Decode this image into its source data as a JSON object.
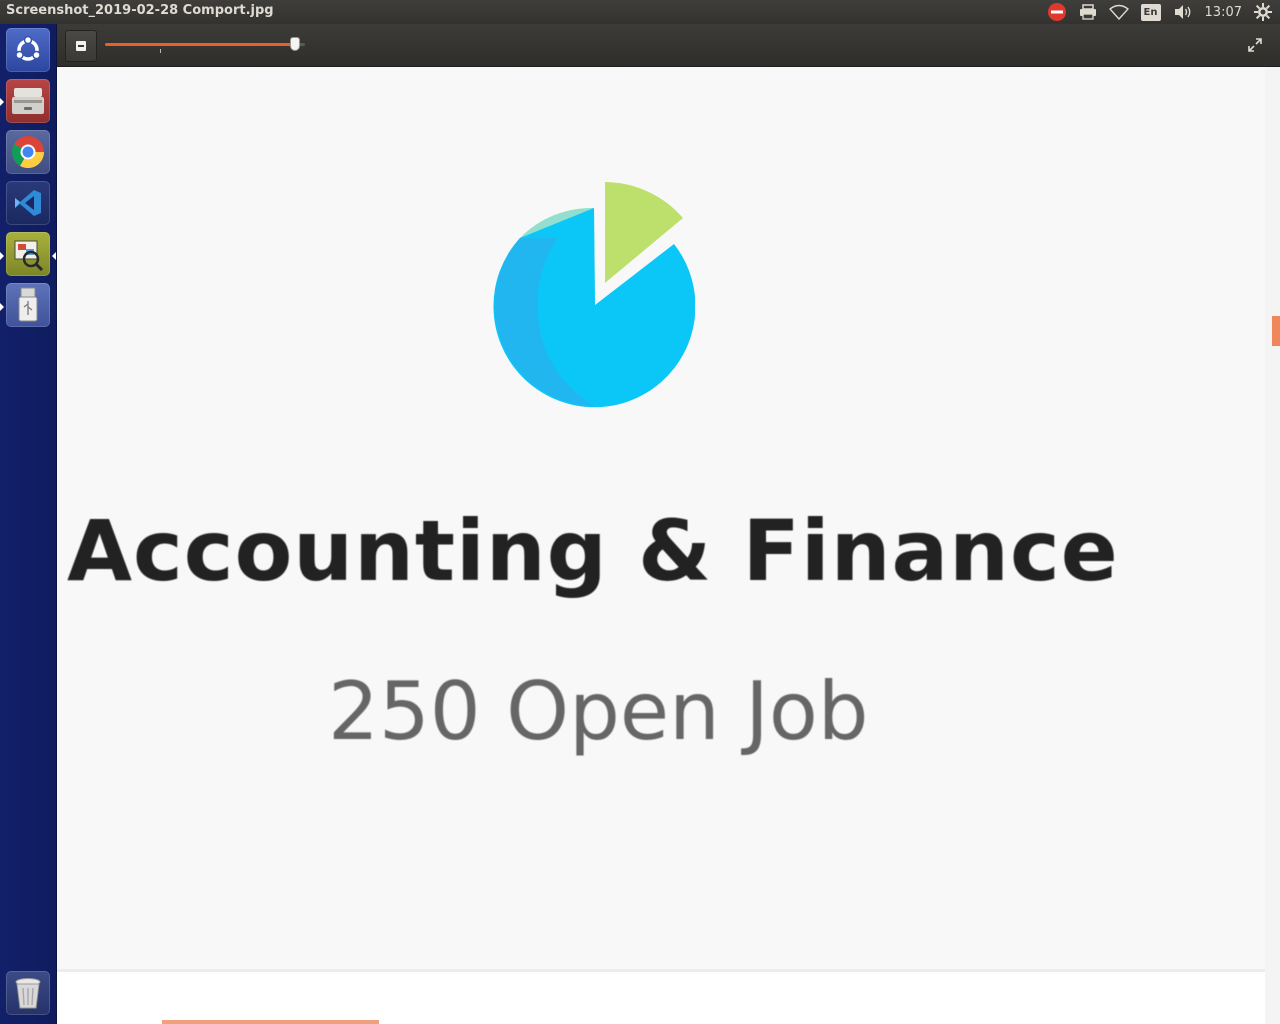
{
  "window": {
    "title": "Screenshot_2019-02-28 Comport.jpg"
  },
  "panel": {
    "keyboard_layout": "En",
    "clock": "13:07"
  },
  "launcher": {
    "items": [
      {
        "icon": "ubuntu-dash-icon"
      },
      {
        "icon": "files-drawer-icon"
      },
      {
        "icon": "chrome-icon"
      },
      {
        "icon": "vscode-icon"
      },
      {
        "icon": "image-viewer-icon"
      },
      {
        "icon": "usb-drive-icon"
      }
    ],
    "trash_icon": "trash-icon"
  },
  "viewer": {
    "zoom_level": 0.95,
    "accent_color": "#e9602b"
  },
  "image_content": {
    "category_title": "Accounting & Finance",
    "open_jobs": "250 Open Job",
    "icon": "pie-chart-icon",
    "colors": {
      "pie_main": "#0bc7f7",
      "pie_shade": "#27b3ef",
      "pie_teal": "#92dfd0",
      "pie_green": "#bde06c"
    }
  }
}
